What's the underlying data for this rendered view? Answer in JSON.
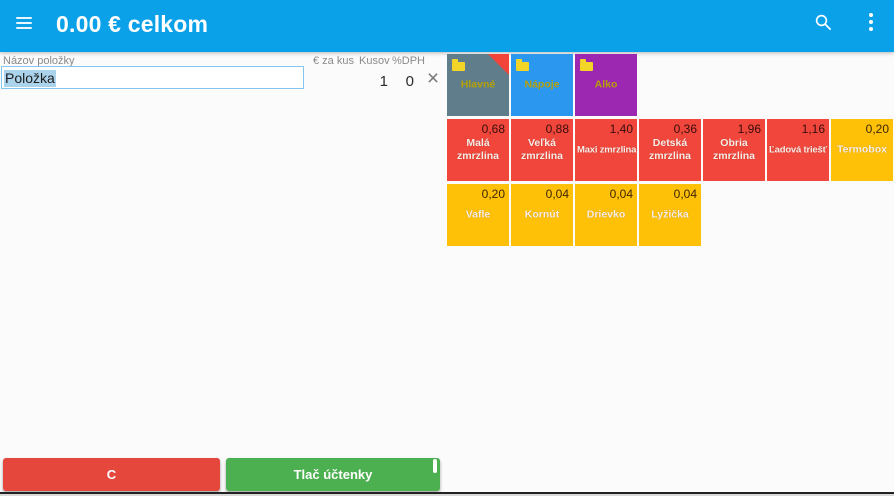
{
  "appbar": {
    "title": "0.00 € celkom",
    "menu_icon": "hamburger-icon",
    "search_icon": "search-icon",
    "overflow_icon": "kebab-menu-icon"
  },
  "form": {
    "name_label": "Názov položky",
    "name_value": "Položka",
    "price_header": "€ za kus",
    "qty_header": "Kusov",
    "vat_header": "%DPH",
    "qty_value": "1",
    "vat_value": "0",
    "clear_icon": "×"
  },
  "colors": {
    "appbar": "#0BA1E9",
    "category_gray": "#607D8B",
    "category_blue": "#2B97EE",
    "category_purple": "#9C27B0",
    "item_red": "#F1463B",
    "item_amber": "#FFC107",
    "clear_button": "#E5473C",
    "print_button": "#4CAF50",
    "selection_highlight": "#ABD3EC"
  },
  "tiles": [
    {
      "label": "Hlavné",
      "type": "category",
      "color": "#607D8B",
      "row": 0,
      "col": 0,
      "folder": true,
      "corner": true
    },
    {
      "label": "Nápoje",
      "type": "category",
      "color": "#2B97EE",
      "row": 0,
      "col": 1,
      "folder": true
    },
    {
      "label": "Alko",
      "type": "category",
      "color": "#9C27B0",
      "row": 0,
      "col": 2,
      "folder": true
    },
    {
      "label": "Malá zmrzlina",
      "type": "item",
      "price": "0,68",
      "color": "#F1463B",
      "row": 1,
      "col": 0
    },
    {
      "label": "Veľká zmrzlina",
      "type": "item",
      "price": "0,88",
      "color": "#F1463B",
      "row": 1,
      "col": 1
    },
    {
      "label": "Maxi zmrzlina",
      "type": "item",
      "price": "1,40",
      "color": "#F1463B",
      "row": 1,
      "col": 2
    },
    {
      "label": "Detská zmrzlina",
      "type": "item",
      "price": "0,36",
      "color": "#F1463B",
      "row": 1,
      "col": 3
    },
    {
      "label": "Obria zmrzlina",
      "type": "item",
      "price": "1,96",
      "color": "#F1463B",
      "row": 1,
      "col": 4
    },
    {
      "label": "Ľadová triešť",
      "type": "item",
      "price": "1,16",
      "color": "#F1463B",
      "row": 1,
      "col": 5
    },
    {
      "label": "Termobox",
      "type": "item",
      "price": "0,20",
      "color": "#FFC107",
      "row": 1,
      "col": 6
    },
    {
      "label": "Vafle",
      "type": "item",
      "price": "0,20",
      "color": "#FFC107",
      "row": 2,
      "col": 0
    },
    {
      "label": "Kornút",
      "type": "item",
      "price": "0,04",
      "color": "#FFC107",
      "row": 2,
      "col": 1
    },
    {
      "label": "Drievko",
      "type": "item",
      "price": "0,04",
      "color": "#FFC107",
      "row": 2,
      "col": 2
    },
    {
      "label": "Lyžička",
      "type": "item",
      "price": "0,04",
      "color": "#FFC107",
      "row": 2,
      "col": 3
    }
  ],
  "footer": {
    "clear_label": "C",
    "print_label": "Tlač účtenky"
  }
}
